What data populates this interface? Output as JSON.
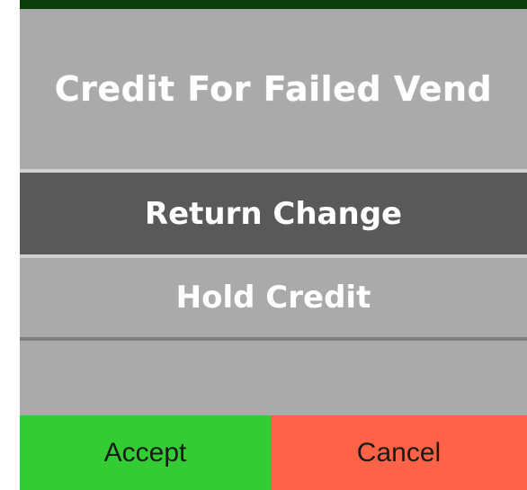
{
  "dialog": {
    "title": "Credit For Failed Vend",
    "options": [
      {
        "label": "Return Change",
        "selected": true
      },
      {
        "label": "Hold Credit",
        "selected": false
      }
    ]
  },
  "buttons": {
    "accept_label": "Accept",
    "cancel_label": "Cancel"
  },
  "colors": {
    "top_bar": "#0b3d0b",
    "panel": "#aaaaaa",
    "selected_option": "#595959",
    "accept": "#33cc33",
    "cancel": "#ff6347"
  }
}
